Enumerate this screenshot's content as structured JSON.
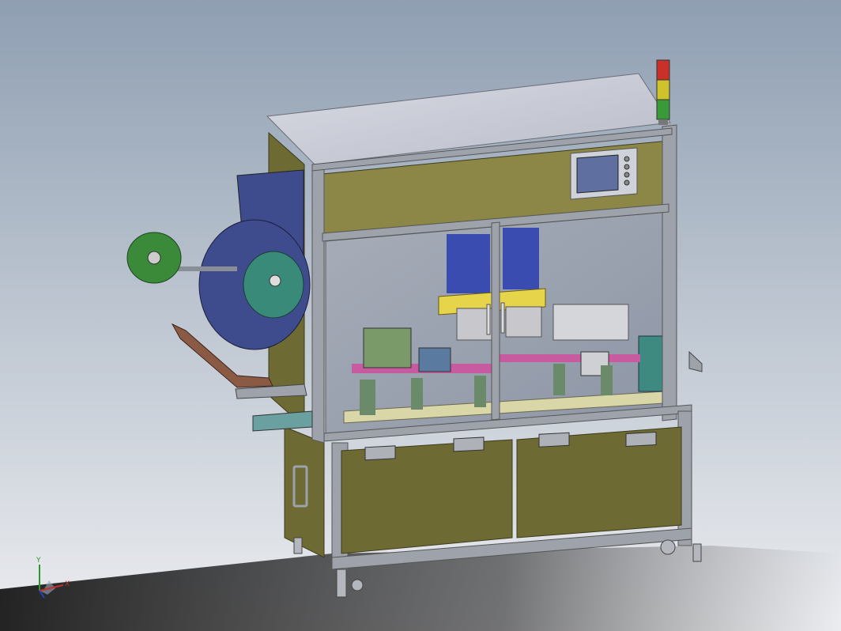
{
  "viewport": {
    "background_top": "#8f9fb2",
    "background_bottom": "#ecedf0"
  },
  "machine": {
    "frame_color": "#9ea3ab",
    "panel_color": "#6e6a33",
    "panel_highlight": "#8c8746",
    "roof_color": "#c7c9d4",
    "glass_tint": "#9ba4b2",
    "reel_color": "#3e4b8d",
    "hub_color": "#3a8a3a",
    "tape_arm_color": "#8a5a44",
    "hmi_screen_color": "#5e6fa0"
  },
  "signal_tower": {
    "lights": [
      "#c8302a",
      "#d0c22a",
      "#3a9a3a"
    ]
  },
  "triad": {
    "x_label": "X",
    "y_label": "Y",
    "x_color": "#c03030",
    "y_color": "#2a9a2a",
    "z_color": "#2a40c0"
  }
}
